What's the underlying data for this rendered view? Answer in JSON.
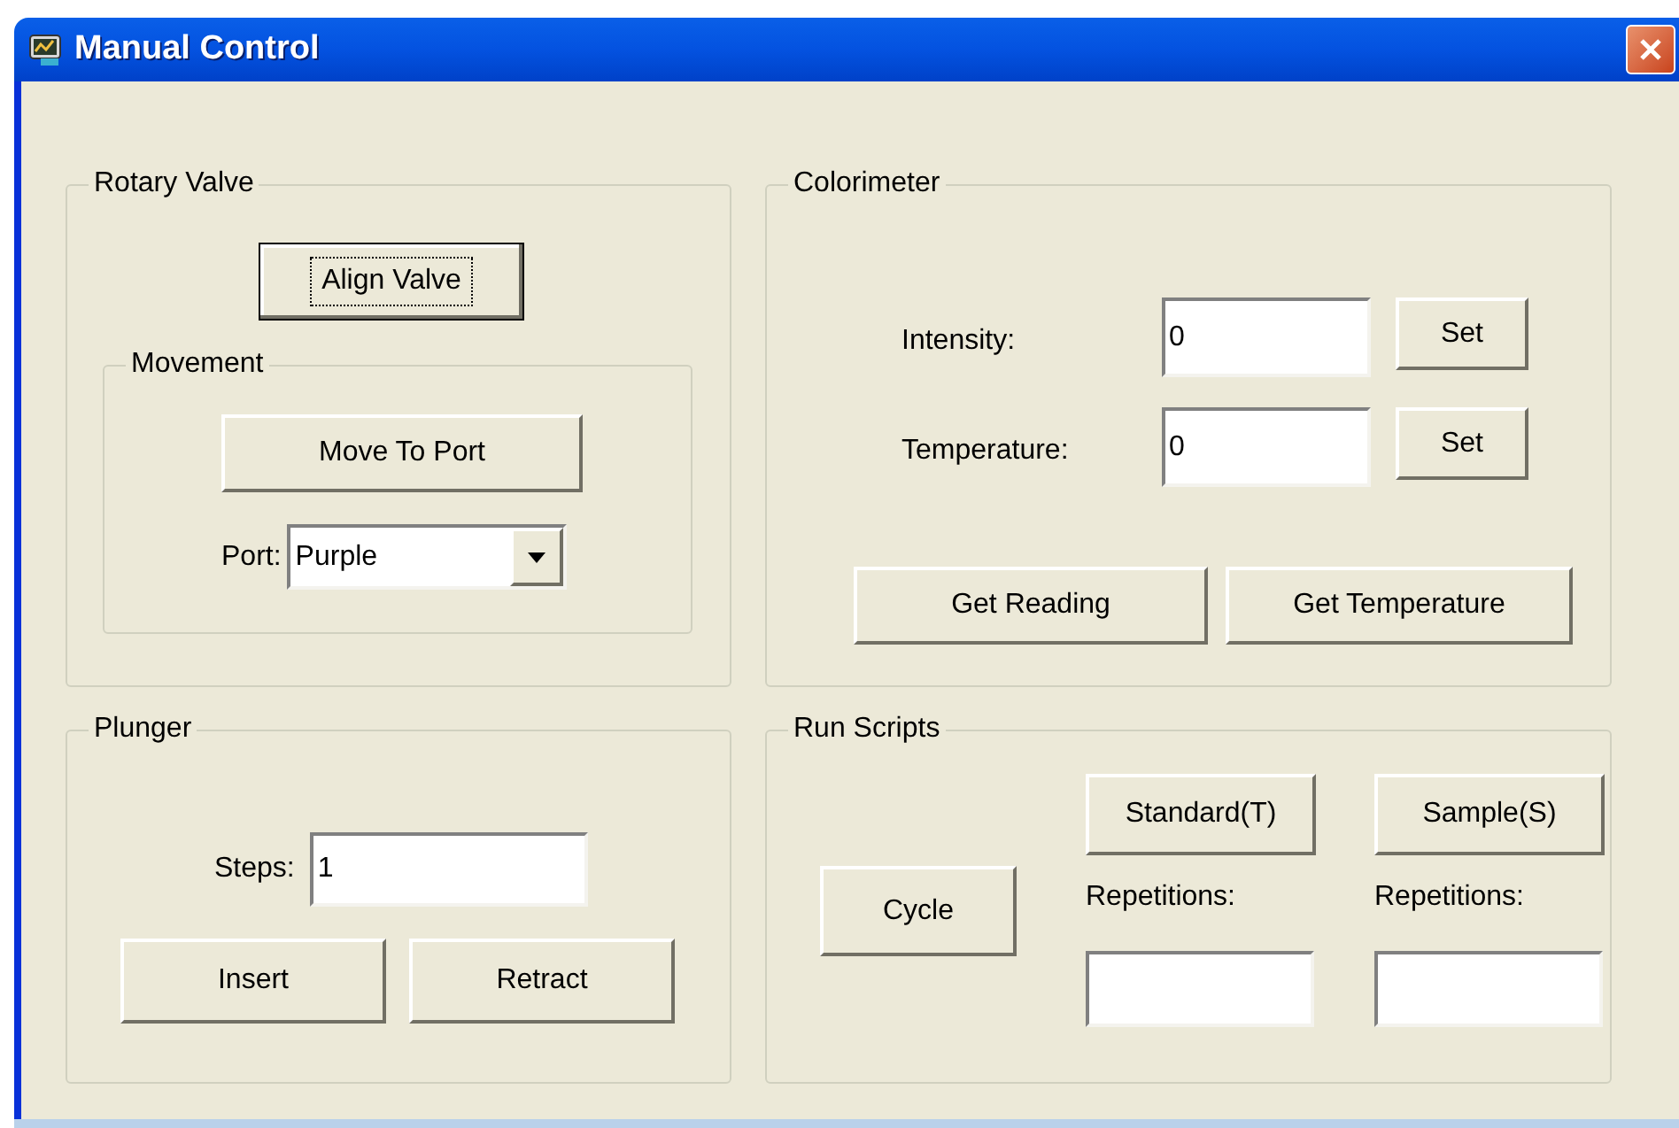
{
  "window": {
    "title": "Manual Control"
  },
  "rotary_valve": {
    "label": "Rotary Valve",
    "align_button": {
      "label": "Align Valve",
      "focused": true
    },
    "movement": {
      "label": "Movement",
      "move_button": "Move To Port",
      "port_label": "Port:",
      "port_value": "Purple"
    }
  },
  "colorimeter": {
    "label": "Colorimeter",
    "rows": [
      {
        "label": "Intensity:",
        "value": "0",
        "button": "Set"
      },
      {
        "label": "Temperature:",
        "value": "0",
        "button": "Set"
      }
    ],
    "buttons": [
      "Get Reading",
      "Get Temperature"
    ]
  },
  "plunger": {
    "label": "Plunger",
    "steps_label": "Steps:",
    "steps_value": "1",
    "buttons": [
      "Insert",
      "Retract"
    ]
  },
  "run_scripts": {
    "label": "Run Scripts",
    "cycle_button": "Cycle",
    "columns": [
      {
        "button": "Standard(T)",
        "label": "Repetitions:"
      },
      {
        "button": "Sample(S)",
        "label": "Repetitions:"
      }
    ]
  }
}
